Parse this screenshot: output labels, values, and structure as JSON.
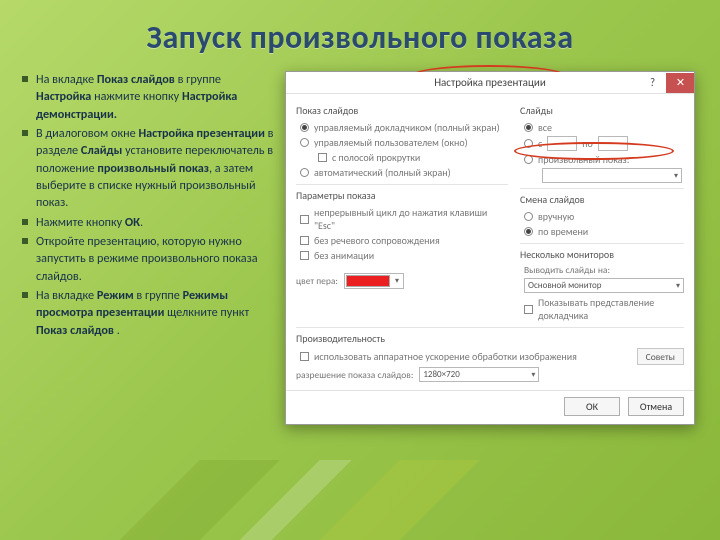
{
  "title": "Запуск произвольного показа",
  "bullets": [
    {
      "parts": [
        "На вкладке ",
        "<b>Показ слайдов</b>",
        " в группе ",
        "<b>Настройка</b>",
        " нажмите кнопку ",
        "<b>Настройка демонстрации.</b>"
      ]
    },
    {
      "parts": [
        "В диалоговом окне ",
        "<b>Настройка презентации</b>",
        " в разделе ",
        "<b>Слайды</b>",
        " установите переключатель в положение ",
        "<b>произвольный показ</b>",
        ", а затем выберите в списке нужный произвольный показ."
      ]
    },
    {
      "parts": [
        "Нажмите кнопку ",
        "<b>ОК</b>",
        "."
      ]
    },
    {
      "parts": [
        "Откройте презентацию, которую нужно запустить в режиме произвольного показа слайдов."
      ]
    },
    {
      "parts": [
        "На вкладке ",
        "<b>Режим</b>",
        " в группе ",
        "<b>Режимы просмотра презентации</b>",
        " щелкните пункт ",
        "<b>Показ слайдов</b>",
        " ."
      ]
    }
  ],
  "dialog": {
    "caption": "Настройка презентации",
    "help": "?",
    "close": "✕",
    "left": {
      "group1_title": "Показ слайдов",
      "opt_speaker": "управляемый докладчиком (полный экран)",
      "opt_individual": "управляемый пользователем (окно)",
      "opt_scroll": "с полосой прокрутки",
      "opt_kiosk": "автоматический (полный экран)",
      "group2_title": "Параметры показа",
      "opt_loop": "непрерывный цикл до нажатия клавиши \"Esc\"",
      "opt_narration": "без речевого сопровождения",
      "opt_animation": "без анимации",
      "pen_label": "цвет пера:"
    },
    "right": {
      "group1_title": "Слайды",
      "opt_all": "все",
      "opt_from": "с",
      "to_label": "по",
      "opt_custom": "произвольный показ:",
      "custom_value": "",
      "group2_title": "Смена слайдов",
      "opt_manual": "вручную",
      "opt_timings": "по времени",
      "group3_title": "Несколько мониторов",
      "display_label": "Выводить слайды на:",
      "display_value": "Основной монитор",
      "presenter_view": "Показывать представление докладчика"
    },
    "perf": {
      "title": "Производительность",
      "hw": "использовать аппаратное ускорение обработки изображения",
      "tips": "Советы",
      "res_label": "разрешение показа слайдов:",
      "res_value": "1280×720"
    },
    "ok": "ОК",
    "cancel": "Отмена"
  }
}
